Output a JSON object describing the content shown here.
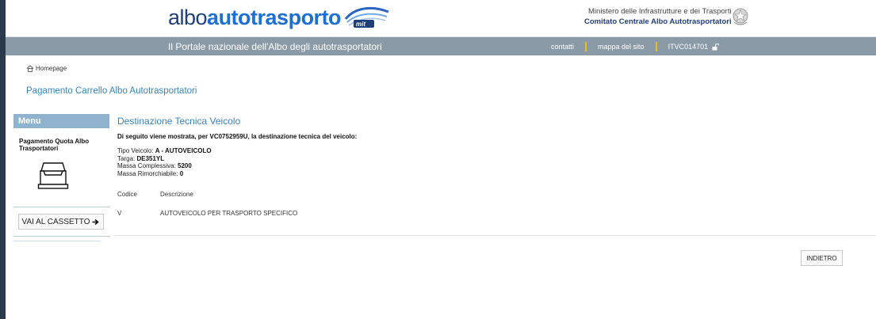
{
  "header": {
    "logo_albo": "albo",
    "logo_autotrasporto": "autotrasporto",
    "logo_badge": "mit",
    "ministry_line1": "Ministero delle Infrastrutture e dei Trasporti",
    "ministry_line2": "Comitato Centrale Albo Autotrasportatori"
  },
  "navbar": {
    "portal_title": "Il Portale nazionale dell'Albo degli autotrasportatori",
    "links": [
      "contatti",
      "mappa del sito",
      "ITVC014701"
    ]
  },
  "breadcrumb": {
    "home": "Homepage"
  },
  "page_title": "Pagamento Carrello Albo Autotrasportatori",
  "sidebar": {
    "menu_title": "Menu",
    "item_label": "Pagamento Quota Albo Trasportatori",
    "cassetto_button": "VAI AL CASSETTO"
  },
  "main": {
    "title": "Destinazione Tecnica Veicolo",
    "intro": "Di seguito viene mostrata, per VC0752959U, la destinazione tecnica del veicolo:",
    "tipo_label": "Tipo Veicolo: ",
    "tipo_value": "A - AUTOVEICOLO",
    "targa_label": "Targa: ",
    "targa_value": "DE351YL",
    "massa_label": "Massa Complessiva: ",
    "massa_value": "5200",
    "rimorchiabile_label": "Massa Rimorchiabile: ",
    "rimorchiabile_value": "0",
    "table": {
      "headers": [
        "Codice",
        "Descrizione"
      ],
      "rows": [
        [
          "V",
          "AUTOVEICOLO PER TRASPORTO SPECIFICO"
        ]
      ]
    },
    "back_button": "INDIETRO"
  },
  "colors": {
    "nav_bg": "#8a9aa6",
    "accent_blue": "#3a83b8",
    "menu_header_bg": "#8fb2cf",
    "nav_separator": "#e8c21a"
  }
}
